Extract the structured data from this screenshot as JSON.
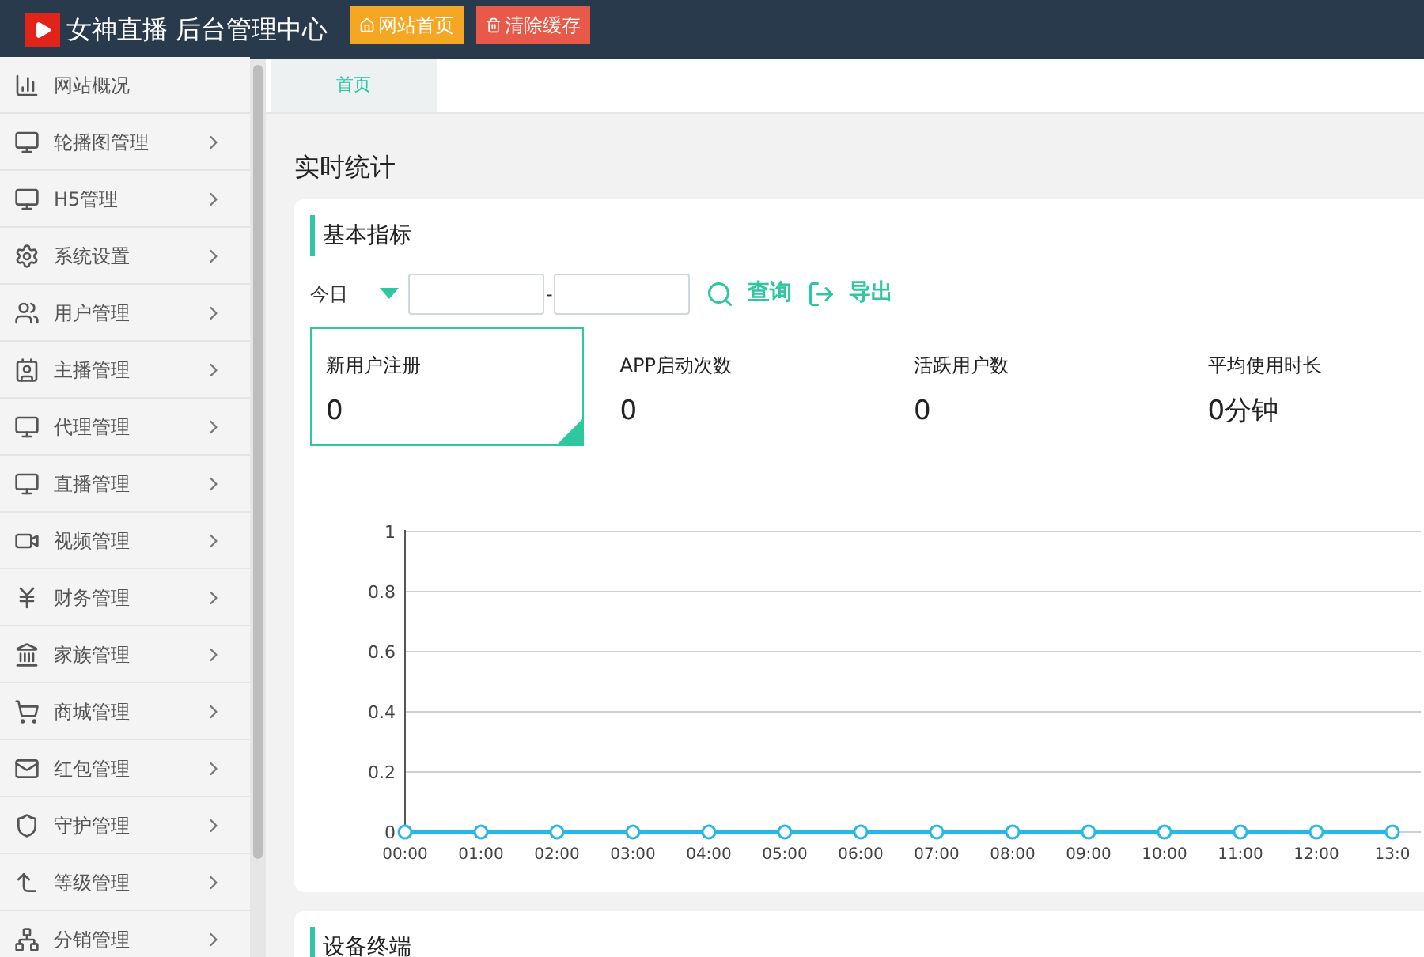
{
  "header": {
    "title": "女神直播 后台管理中心",
    "buttons": [
      {
        "label": "网站首页",
        "kind": "home"
      },
      {
        "label": "清除缓存",
        "kind": "clear"
      }
    ]
  },
  "sidebar": {
    "items": [
      {
        "label": "网站概况",
        "expandable": false
      },
      {
        "label": "轮播图管理",
        "expandable": true
      },
      {
        "label": "H5管理",
        "expandable": true
      },
      {
        "label": "系统设置",
        "expandable": true
      },
      {
        "label": "用户管理",
        "expandable": true
      },
      {
        "label": "主播管理",
        "expandable": true
      },
      {
        "label": "代理管理",
        "expandable": true
      },
      {
        "label": "直播管理",
        "expandable": true
      },
      {
        "label": "视频管理",
        "expandable": true
      },
      {
        "label": "财务管理",
        "expandable": true
      },
      {
        "label": "家族管理",
        "expandable": true
      },
      {
        "label": "商城管理",
        "expandable": true
      },
      {
        "label": "红包管理",
        "expandable": true
      },
      {
        "label": "守护管理",
        "expandable": true
      },
      {
        "label": "等级管理",
        "expandable": true
      },
      {
        "label": "分销管理",
        "expandable": true
      }
    ]
  },
  "tabs": [
    {
      "label": "首页",
      "selected": true
    }
  ],
  "page_title": "实时统计",
  "basic_metrics": {
    "title": "基本指标",
    "period": "今日",
    "separator": "-",
    "actions": [
      {
        "label": "查询",
        "kind": "search"
      },
      {
        "label": "导出",
        "kind": "export"
      }
    ],
    "stats": [
      {
        "label": "新用户注册",
        "value": "0",
        "selected": true
      },
      {
        "label": "APP启动次数",
        "value": "0",
        "selected": false
      },
      {
        "label": "活跃用户数",
        "value": "0",
        "selected": false
      },
      {
        "label": "平均使用时长",
        "value": "0分钟",
        "selected": false
      }
    ],
    "chart_data": {
      "type": "line",
      "categories": [
        "00:00",
        "01:00",
        "02:00",
        "03:00",
        "04:00",
        "05:00",
        "06:00",
        "07:00",
        "08:00",
        "09:00",
        "10:00",
        "11:00",
        "12:00",
        "13:0"
      ],
      "grid": true,
      "series": [
        {
          "color": "#29b6e8",
          "marker": true,
          "values": [
            0,
            0,
            0,
            0,
            0,
            0,
            0,
            0,
            0,
            0,
            0,
            0,
            0,
            0
          ]
        }
      ],
      "ylim": [
        0,
        1
      ],
      "yticks": [
        0,
        0.2,
        0.4,
        0.6,
        0.8,
        1
      ]
    }
  },
  "devices": {
    "title": "设备终端"
  }
}
